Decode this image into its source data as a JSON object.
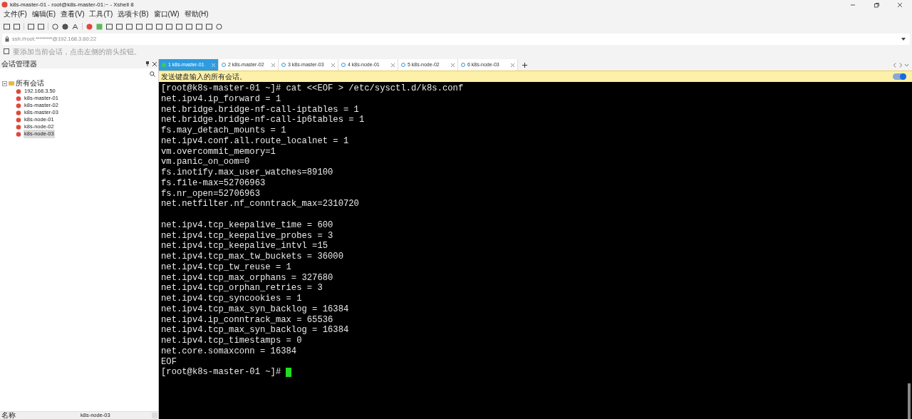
{
  "window": {
    "title": "k8s-master-01 - root@k8s-master-01:~ - Xshell 8"
  },
  "menu": [
    "文件(F)",
    "编辑(E)",
    "查看(V)",
    "工具(T)",
    "选项卡(B)",
    "窗口(W)",
    "帮助(H)"
  ],
  "address": {
    "value": "ssh://root:********@192.168.3.60:22"
  },
  "hint_bar": {
    "text": "要添加当前会话，点击左侧的箭头按钮。"
  },
  "sidebar": {
    "title": "会话管理器",
    "root": {
      "label": "所有会话",
      "expanded": true,
      "children": [
        {
          "label": "192.168.3.50",
          "selected": false
        },
        {
          "label": "k8s-master-01",
          "selected": false
        },
        {
          "label": "k8s-master-02",
          "selected": false
        },
        {
          "label": "k8s-master-03",
          "selected": false
        },
        {
          "label": "k8s-node-01",
          "selected": false
        },
        {
          "label": "k8s-node-02",
          "selected": false
        },
        {
          "label": "k8s-node-03",
          "selected": true
        }
      ]
    },
    "footer": {
      "column_1": "名称",
      "column_2": "k8s-node-03"
    }
  },
  "tabs": [
    {
      "label": "1 k8s-master-01",
      "selected": true
    },
    {
      "label": "2 k8s-master-02",
      "selected": false
    },
    {
      "label": "3 k8s-master-03",
      "selected": false
    },
    {
      "label": "4 k8s-node-01",
      "selected": false
    },
    {
      "label": "5 k8s-node-02",
      "selected": false
    },
    {
      "label": "6 k8s-node-03",
      "selected": false
    }
  ],
  "broadcast_bar": {
    "text": "发送键盘输入的所有会话。",
    "on": true
  },
  "terminal": {
    "blocks": [
      [
        "[root@k8s-master-01 ~]# cat <<EOF > /etc/sysctl.d/k8s.conf",
        "net.ipv4.ip_forward = 1",
        "net.bridge.bridge-nf-call-iptables = 1",
        "net.bridge.bridge-nf-call-ip6tables = 1",
        "fs.may_detach_mounts = 1",
        "net.ipv4.conf.all.route_localnet = 1",
        "vm.overcommit_memory=1",
        "vm.panic_on_oom=0",
        "fs.inotify.max_user_watches=89100",
        "fs.file-max=52706963",
        "fs.nr_open=52706963",
        "net.netfilter.nf_conntrack_max=2310720"
      ],
      [
        "net.ipv4.tcp_keepalive_time = 600",
        "net.ipv4.tcp_keepalive_probes = 3",
        "net.ipv4.tcp_keepalive_intvl =15",
        "net.ipv4.tcp_max_tw_buckets = 36000",
        "net.ipv4.tcp_tw_reuse = 1",
        "net.ipv4.tcp_max_orphans = 327680",
        "net.ipv4.tcp_orphan_retries = 3",
        "net.ipv4.tcp_syncookies = 1",
        "net.ipv4.tcp_max_syn_backlog = 16384",
        "net.ipv4.ip_conntrack_max = 65536",
        "net.ipv4.tcp_max_syn_backlog = 16384",
        "net.ipv4.tcp_timestamps = 0",
        "net.core.somaxconn = 16384",
        "EOF"
      ]
    ],
    "prompt": "[root@k8s-master-01 ~]#"
  }
}
